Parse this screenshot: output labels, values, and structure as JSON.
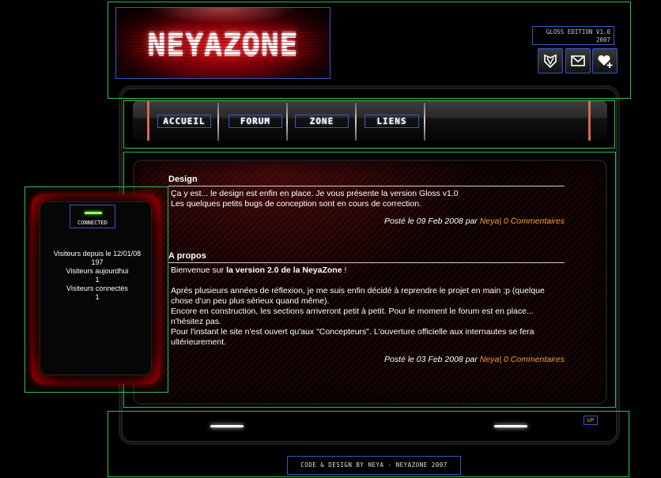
{
  "header": {
    "logo_text": "NEYAZONE",
    "edition_line1": "GLOSS EDITION V1.0",
    "edition_line2": "2007",
    "icons": [
      "shield-icon",
      "mail-icon",
      "heart-plus-icon"
    ]
  },
  "nav": {
    "items": [
      "ACCUEIL",
      "FORUM",
      "ZONE",
      "LIENS"
    ]
  },
  "sidebar": {
    "connected_label": "CONNECTED",
    "stats": [
      "Visiteurs depuis le 12/01/08",
      "197",
      "Visiteurs aujourdhui",
      "1",
      "Visiteurs connectés",
      "1"
    ]
  },
  "articles": [
    {
      "title": "Design",
      "lines": [
        "Ça y est... le design est enfin en place. Je vous présente la version Gloss v1.0",
        "Les quelques petits bugs de conception sont en cours de correction."
      ],
      "meta_prefix": "Posté le 09 Feb 2008 par",
      "author": "Neya",
      "sep": "|",
      "comments": "0 Commentaires"
    },
    {
      "title": "A propos",
      "intro_pre": "Bienvenue sur",
      "intro_bold": "la version 2.0 de la NeyaZone",
      "intro_post": "!",
      "paragraph": "Après plusieurs années de réflexion, je me suis enfin décidé à reprendre le projet en main :p (quelque chose d'un peu plus sérieux quand même).",
      "line2": "Encore en construction, les sections arriveront petit à petit. Pour le moment le forum est en place... n'hésitez pas.",
      "line3": "Pour l'instant le site n'est ouvert qu'aux \"Concepteurs\". L'ouverture officielle aux internautes se fera ultérieurement.",
      "meta_prefix": "Posté le 03 Feb 2008 par",
      "author": "Neya",
      "sep": "|",
      "comments": "0 Commentaires"
    }
  ],
  "footer": {
    "up_label": "UP",
    "credit": "CODE & DESIGN BY NEYA - NEYAZONE 2007"
  },
  "colors": {
    "accent_orange": "#f5a030",
    "frame_green": "#2fbf55",
    "box_blue": "#3b55c8",
    "logo_red": "#c4101a"
  }
}
